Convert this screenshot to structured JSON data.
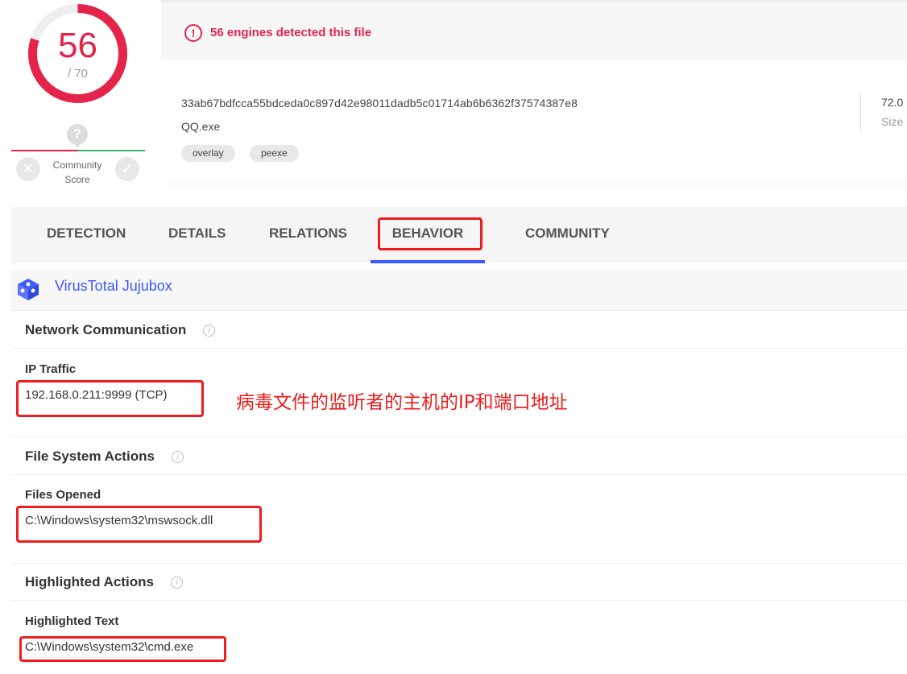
{
  "score": {
    "detected": "56",
    "total": "/ 70",
    "detected_fraction": 0.8
  },
  "community": {
    "label_line1": "Community",
    "label_line2": "Score",
    "question": "?",
    "bad": "✕",
    "good": "✓"
  },
  "alert": {
    "icon": "!",
    "text": "56 engines detected this file"
  },
  "file": {
    "hash": "33ab67bdfcca55bdceda0c897d42e98011dadb5c01714ab6b6362f37574387e8",
    "name": "QQ.exe",
    "tags": [
      "overlay",
      "peexe"
    ],
    "size_value": "72.0",
    "size_label": "Size"
  },
  "tabs": [
    "DETECTION",
    "DETAILS",
    "RELATIONS",
    "BEHAVIOR",
    "COMMUNITY"
  ],
  "sandbox": {
    "name": "VirusTotal Jujubox",
    "icon": "sandbox-box-icon"
  },
  "sections": {
    "network": {
      "title": "Network Communication",
      "sub": "IP Traffic",
      "value": "192.168.0.211:9999 (TCP)"
    },
    "filesystem": {
      "title": "File System Actions",
      "sub": "Files Opened",
      "value": "C:\\Windows\\system32\\mswsock.dll"
    },
    "highlighted": {
      "title": "Highlighted Actions",
      "sub": "Highlighted Text",
      "value": "C:\\Windows\\system32\\cmd.exe"
    }
  },
  "annotation": "病毒文件的监听者的主机的IP和端口地址",
  "colors": {
    "alert_red": "#e4244b",
    "accent_blue": "#3d5afe",
    "annotation_red": "#ee1c1c"
  }
}
